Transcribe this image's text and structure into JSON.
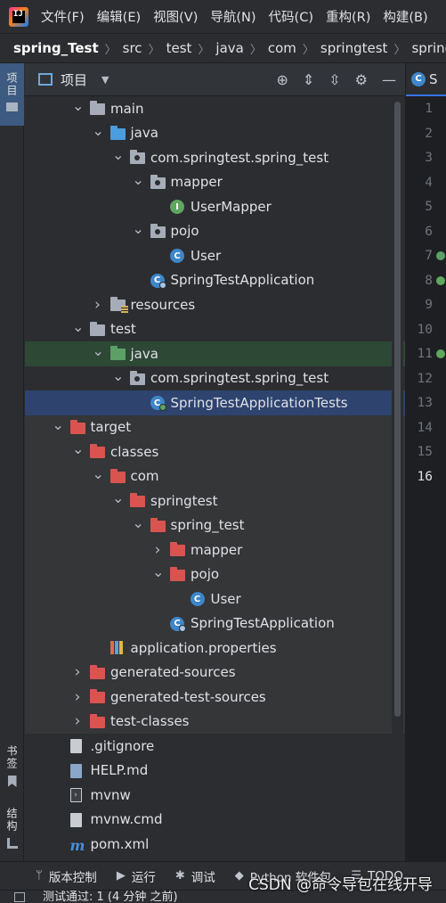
{
  "menu": [
    "文件(F)",
    "编辑(E)",
    "视图(V)",
    "导航(N)",
    "代码(C)",
    "重构(R)",
    "构建(B)"
  ],
  "logo_text": "IJ",
  "breadcrumb": [
    "spring_Test",
    "src",
    "test",
    "java",
    "com",
    "springtest",
    "spring_test"
  ],
  "left_strip": {
    "project": "项目",
    "bookmarks": "书签",
    "structure": "结构"
  },
  "panel": {
    "title": "项目"
  },
  "tree": [
    {
      "label": "main",
      "indent": 2,
      "arrow": "v",
      "icon": "folder-gray"
    },
    {
      "label": "java",
      "indent": 3,
      "arrow": "v",
      "icon": "folder-blue"
    },
    {
      "label": "com.springtest.spring_test",
      "indent": 4,
      "arrow": "v",
      "icon": "package"
    },
    {
      "label": "mapper",
      "indent": 5,
      "arrow": "v",
      "icon": "package"
    },
    {
      "label": "UserMapper",
      "indent": 6,
      "arrow": "",
      "icon": "interface"
    },
    {
      "label": "pojo",
      "indent": 5,
      "arrow": "v",
      "icon": "package"
    },
    {
      "label": "User",
      "indent": 6,
      "arrow": "",
      "icon": "class"
    },
    {
      "label": "SpringTestApplication",
      "indent": 5,
      "arrow": "",
      "icon": "class-run"
    },
    {
      "label": "resources",
      "indent": 3,
      "arrow": ">",
      "icon": "resources"
    },
    {
      "label": "test",
      "indent": 2,
      "arrow": "v",
      "icon": "folder-gray"
    },
    {
      "label": "java",
      "indent": 3,
      "arrow": "v",
      "icon": "folder-green",
      "style": "grn"
    },
    {
      "label": "com.springtest.spring_test",
      "indent": 4,
      "arrow": "v",
      "icon": "package"
    },
    {
      "label": "SpringTestApplicationTests",
      "indent": 5,
      "arrow": "",
      "icon": "class-test",
      "style": "sel"
    },
    {
      "label": "target",
      "indent": 1,
      "arrow": "v",
      "icon": "folder-red",
      "style": "gray"
    },
    {
      "label": "classes",
      "indent": 2,
      "arrow": "v",
      "icon": "folder-red",
      "style": "gray"
    },
    {
      "label": "com",
      "indent": 3,
      "arrow": "v",
      "icon": "folder-red",
      "style": "gray"
    },
    {
      "label": "springtest",
      "indent": 4,
      "arrow": "v",
      "icon": "folder-red",
      "style": "gray"
    },
    {
      "label": "spring_test",
      "indent": 5,
      "arrow": "v",
      "icon": "folder-red",
      "style": "gray"
    },
    {
      "label": "mapper",
      "indent": 6,
      "arrow": ">",
      "icon": "folder-red",
      "style": "gray"
    },
    {
      "label": "pojo",
      "indent": 6,
      "arrow": "v",
      "icon": "folder-red",
      "style": "gray"
    },
    {
      "label": "User",
      "indent": 7,
      "arrow": "",
      "icon": "class",
      "style": "gray"
    },
    {
      "label": "SpringTestApplication",
      "indent": 6,
      "arrow": "",
      "icon": "class-run",
      "style": "gray"
    },
    {
      "label": "application.properties",
      "indent": 3,
      "arrow": "",
      "icon": "properties",
      "style": "gray"
    },
    {
      "label": "generated-sources",
      "indent": 2,
      "arrow": ">",
      "icon": "folder-red",
      "style": "gray"
    },
    {
      "label": "generated-test-sources",
      "indent": 2,
      "arrow": ">",
      "icon": "folder-red",
      "style": "gray"
    },
    {
      "label": "test-classes",
      "indent": 2,
      "arrow": ">",
      "icon": "folder-red",
      "style": "gray"
    },
    {
      "label": ".gitignore",
      "indent": 1,
      "arrow": "",
      "icon": "file"
    },
    {
      "label": "HELP.md",
      "indent": 1,
      "arrow": "",
      "icon": "md"
    },
    {
      "label": "mvnw",
      "indent": 1,
      "arrow": "",
      "icon": "shell"
    },
    {
      "label": "mvnw.cmd",
      "indent": 1,
      "arrow": "",
      "icon": "file"
    },
    {
      "label": "pom.xml",
      "indent": 1,
      "arrow": "",
      "icon": "maven"
    }
  ],
  "editor": {
    "tab_label": "S",
    "line_numbers": [
      "1",
      "2",
      "3",
      "4",
      "5",
      "6",
      "7",
      "8",
      "9",
      "10",
      "11",
      "12",
      "13",
      "14",
      "15",
      "16"
    ],
    "current_line": "16"
  },
  "tool_windows": [
    {
      "label": "版本控制",
      "icon": "vcs-icon"
    },
    {
      "label": "运行",
      "icon": "run-icon"
    },
    {
      "label": "调试",
      "icon": "debug-icon"
    },
    {
      "label": "Python 软件包",
      "icon": "python-packages-icon"
    },
    {
      "label": "TODO",
      "icon": "todo-icon"
    }
  ],
  "status": {
    "text": "测试通过: 1 (4 分钟 之前)"
  },
  "watermark": "CSDN @命令导包在线开导",
  "colors": {
    "accent": "#3574f0",
    "selection": "#2e436e",
    "excluded_folder": "#d9534f",
    "source_folder": "#4a9edf",
    "test_folder": "#5ca066"
  }
}
